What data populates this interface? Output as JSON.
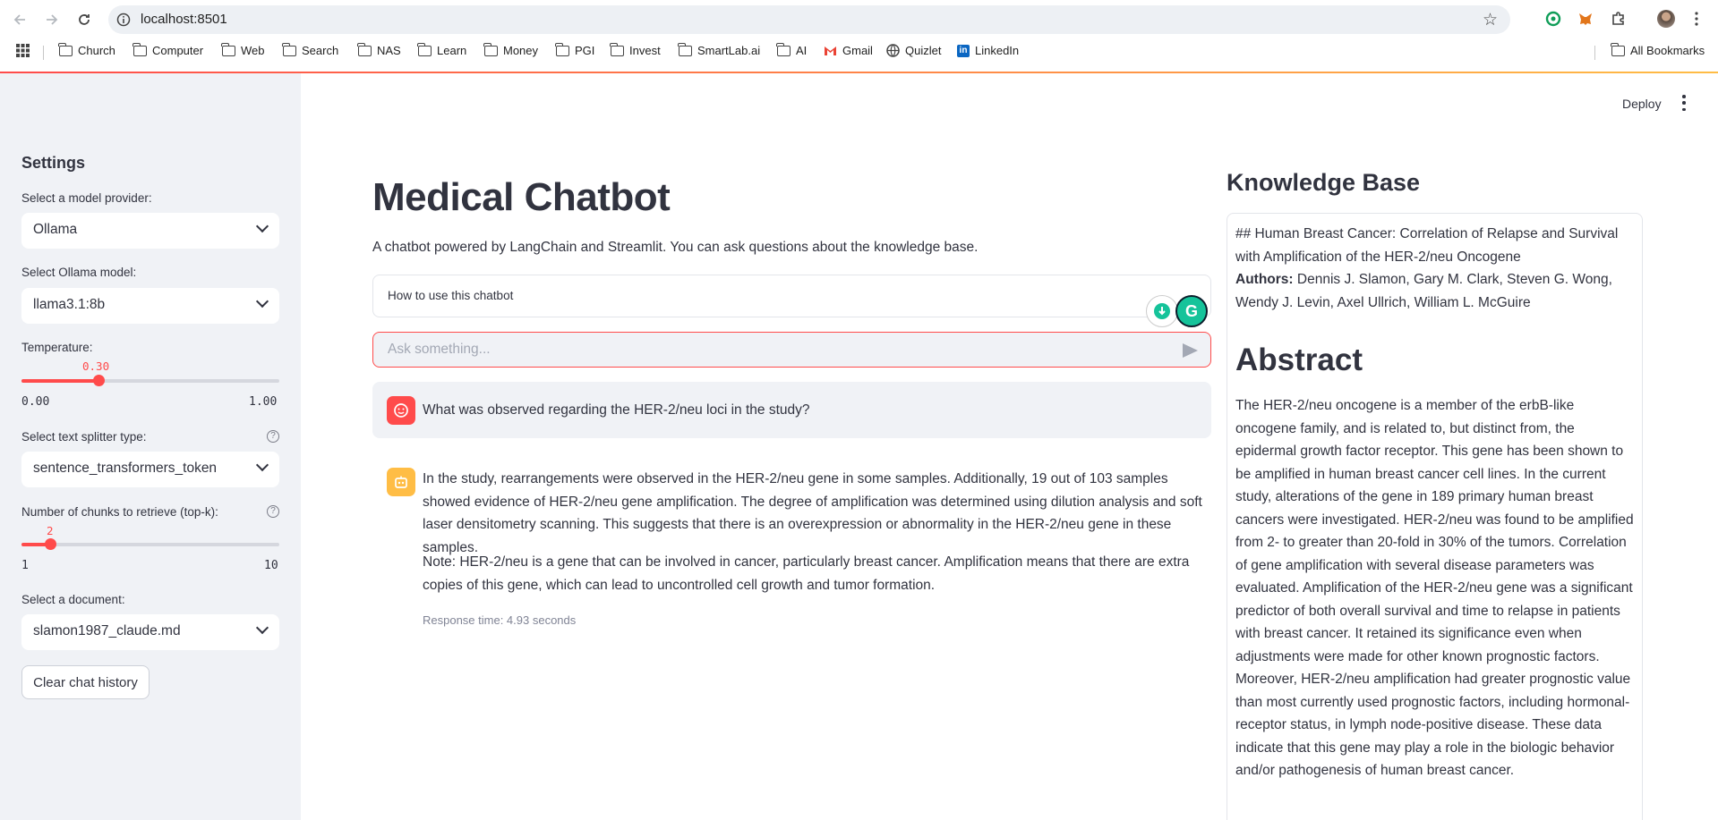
{
  "browser": {
    "url": "localhost:8501",
    "bookmarks": [
      "Church",
      "Computer",
      "Web",
      "Search",
      "NAS",
      "Learn",
      "Money",
      "PGI",
      "Invest",
      "SmartLab.ai",
      "AI",
      "Gmail",
      "Quizlet",
      "LinkedIn"
    ],
    "all_bookmarks": "All Bookmarks"
  },
  "header": {
    "deploy_label": "Deploy"
  },
  "sidebar": {
    "title": "Settings",
    "provider_label": "Select a model provider:",
    "provider_value": "Ollama",
    "model_label": "Select Ollama model:",
    "model_value": "llama3.1:8b",
    "temperature_label": "Temperature:",
    "temperature_value": "0.30",
    "temperature_fraction": 0.3,
    "temperature_min": "0.00",
    "temperature_max": "1.00",
    "splitter_label": "Select text splitter type:",
    "splitter_value": "sentence_transformers_token",
    "topk_label": "Number of chunks to retrieve (top-k):",
    "topk_value": "2",
    "topk_fraction": 0.111,
    "topk_min": "1",
    "topk_max": "10",
    "document_label": "Select a document:",
    "document_value": "slamon1987_claude.md",
    "clear_label": "Clear chat history",
    "help_glyph": "?"
  },
  "main": {
    "title": "Medical Chatbot",
    "caption": "A chatbot powered by LangChain and Streamlit. You can ask questions about the knowledge base.",
    "expander_label": "How to use this chatbot",
    "input_placeholder": "Ask something...",
    "user_message": "What was observed regarding the HER-2/neu loci in the study?",
    "assistant_paragraph_1": "In the study, rearrangements were observed in the HER-2/neu gene in some samples. Additionally, 19 out of 103 samples showed evidence of HER-2/neu gene amplification. The degree of amplification was determined using dilution analysis and soft laser densitometry scanning. This suggests that there is an overexpression or abnormality in the HER-2/neu gene in these samples.",
    "assistant_paragraph_2": "Note: HER-2/neu is a gene that can be involved in cancer, particularly breast cancer. Amplification means that there are extra copies of this gene, which can lead to uncontrolled cell growth and tumor formation.",
    "response_time": "Response time: 4.93 seconds"
  },
  "knowledge_base": {
    "title": "Knowledge Base",
    "doc_heading": "## Human Breast Cancer: Correlation of Relapse and Survival with Amplification of the HER-2/neu Oncogene",
    "authors_label": "Authors:",
    "authors": " Dennis J. Slamon, Gary M. Clark, Steven G. Wong, Wendy J. Levin, Axel Ullrich, William L. McGuire",
    "abstract_heading": "Abstract",
    "abstract": "The HER-2/neu oncogene is a member of the erbB-like oncogene family, and is related to, but distinct from, the epidermal growth factor receptor. This gene has been shown to be amplified in human breast cancer cell lines. In the current study, alterations of the gene in 189 primary human breast cancers were investigated. HER-2/neu was found to be amplified from 2- to greater than 20-fold in 30% of the tumors. Correlation of gene amplification with several disease parameters was evaluated. Amplification of the HER-2/neu gene was a significant predictor of both overall survival and time to relapse in patients with breast cancer. It retained its significance even when adjustments were made for other known prognostic factors. Moreover, HER-2/neu amplification had greater prognostic value than most currently used prognostic factors, including hormonal-receptor status, in lymph node-positive disease. These data indicate that this gene may play a role in the biologic behavior and/or pathogenesis of human breast cancer."
  },
  "colors": {
    "accent": "#ff4b4b",
    "sidebar_bg": "#f0f2f6",
    "assistant_avatar": "#ffbd45"
  }
}
